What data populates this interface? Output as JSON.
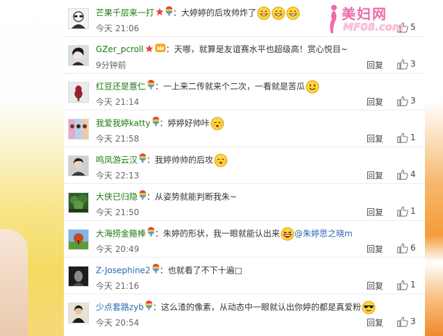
{
  "watermark": {
    "title": "美妇网",
    "url": "MF08.com"
  },
  "labels": {
    "reply": "回复"
  },
  "colors": {
    "username": "#1c7a10",
    "link": "#2b66b1",
    "time": "#666666"
  },
  "comments": [
    {
      "user": "芒果千层来一打",
      "text": "：大婷婷的后攻帅炸了",
      "time": "今天 21:06",
      "likes": "5",
      "has_reply": false,
      "badges": [
        "star-badge",
        "rainbow-balloon-icon"
      ],
      "emoticons": [
        "grin-emoji",
        "grin-emoji",
        "grin-emoji"
      ]
    },
    {
      "user": "GZer_pcroll",
      "text": "：天哪，就算是友谊赛水平也超级高！赏心悦目~",
      "time": "9分钟前",
      "likes": "3",
      "has_reply": true,
      "badges": [
        "star-badge",
        "vip-crown-icon"
      ],
      "emoticons": []
    },
    {
      "user": "红豆还是薏仁",
      "text": "：一上来二传就来个二次，一看就是苦瓜",
      "time": "今天 21:14",
      "likes": "3",
      "has_reply": true,
      "badges": [
        "rainbow-balloon-icon"
      ],
      "emoticons": [
        "smile-emoji"
      ]
    },
    {
      "user": "我爱我婷katty",
      "text": "：婷婷好帅咔",
      "time": "今天 21:58",
      "likes": "1",
      "has_reply": true,
      "badges": [
        "rainbow-balloon-icon"
      ],
      "emoticons": [
        "blush-emoji"
      ]
    },
    {
      "user": "鸣凤游云汉",
      "text": "：我婷帅帅的后攻",
      "time": "今天 22:13",
      "likes": "4",
      "has_reply": true,
      "badges": [
        "rainbow-balloon-icon"
      ],
      "emoticons": [
        "blush-emoji"
      ]
    },
    {
      "user": "大侠已归隐",
      "text": "：从姿势就能判断我朱~",
      "time": "今天 21:50",
      "likes": "1",
      "has_reply": true,
      "badges": [
        "rainbow-balloon-icon"
      ],
      "emoticons": []
    },
    {
      "user": "大海捞金箍棒",
      "text": "：朱婷的形状，我一眼就能认出来",
      "mention": "@朱婷思之晓m",
      "time": "今天 20:49",
      "likes": "6",
      "has_reply": true,
      "badges": [
        "rainbow-balloon-icon"
      ],
      "emoticons": [
        "laugh-emoji"
      ]
    },
    {
      "user": "Z-Josephine2",
      "text": "：也就看了不下十遍□",
      "time": "今天 21:16",
      "likes": "1",
      "has_reply": true,
      "badges": [
        "rainbow-balloon-icon"
      ],
      "emoticons": []
    },
    {
      "user": "少点套路zyb",
      "text": "：这么渣的像素，从动态中一眼就认出你婷的都是真爱粉",
      "time": "今天 20:54",
      "likes": "3",
      "has_reply": true,
      "badges": [
        "rainbow-balloon-icon"
      ],
      "emoticons": [
        "sunglasses-emoji"
      ]
    }
  ]
}
